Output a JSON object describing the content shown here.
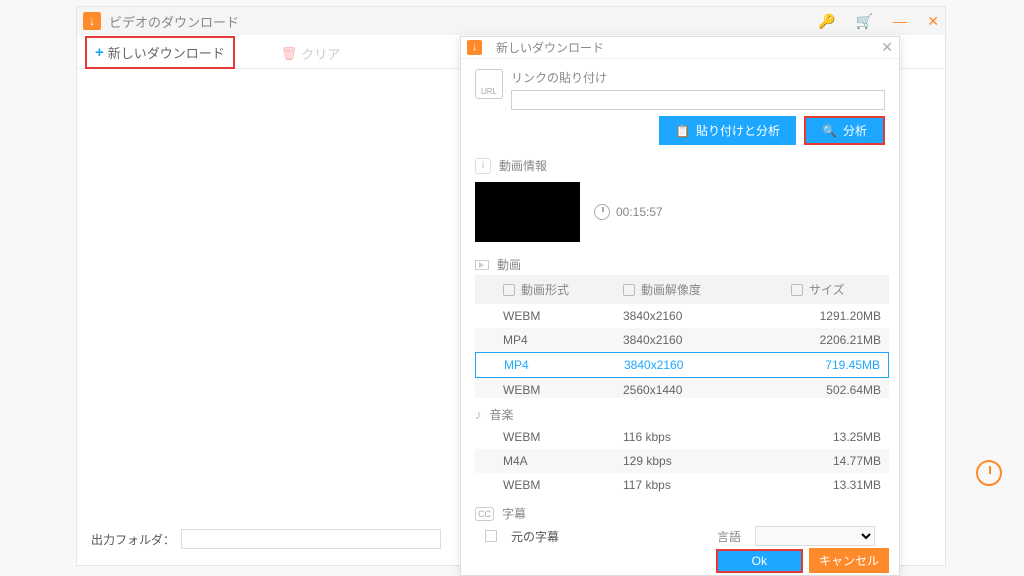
{
  "main": {
    "title": "ビデオのダウンロード",
    "toolbar": {
      "new": "新しいダウンロード",
      "clear": "クリア"
    },
    "output_label": "出力フォルダ：",
    "output_path": ""
  },
  "dialog": {
    "title": "新しいダウンロード",
    "url_icon": "URL",
    "paste_label": "リンクの貼り付け",
    "url_value": "",
    "paste_analyze": "貼り付けと分析",
    "analyze": "分析",
    "info_header": "動画情報",
    "duration": "00:15:57",
    "video_header": "動画",
    "columns": {
      "format": "動画形式",
      "resolution": "動画解像度",
      "size": "サイズ"
    },
    "video_rows": [
      {
        "fmt": "WEBM",
        "res": "3840x2160",
        "size": "1291.20MB",
        "selected": false,
        "alt": false
      },
      {
        "fmt": "MP4",
        "res": "3840x2160",
        "size": "2206.21MB",
        "selected": false,
        "alt": true
      },
      {
        "fmt": "MP4",
        "res": "3840x2160",
        "size": "719.45MB",
        "selected": true,
        "alt": false
      },
      {
        "fmt": "WEBM",
        "res": "2560x1440",
        "size": "502.64MB",
        "selected": false,
        "alt": true
      }
    ],
    "audio_header": "音楽",
    "audio_rows": [
      {
        "fmt": "WEBM",
        "res": "116 kbps",
        "size": "13.25MB",
        "alt": false
      },
      {
        "fmt": "M4A",
        "res": "129 kbps",
        "size": "14.77MB",
        "alt": true
      },
      {
        "fmt": "WEBM",
        "res": "117 kbps",
        "size": "13.31MB",
        "alt": false
      }
    ],
    "subs_header": "字幕",
    "original_sub": "元の字幕",
    "lang_label": "言語",
    "ok": "Ok",
    "cancel": "キャンセル"
  }
}
